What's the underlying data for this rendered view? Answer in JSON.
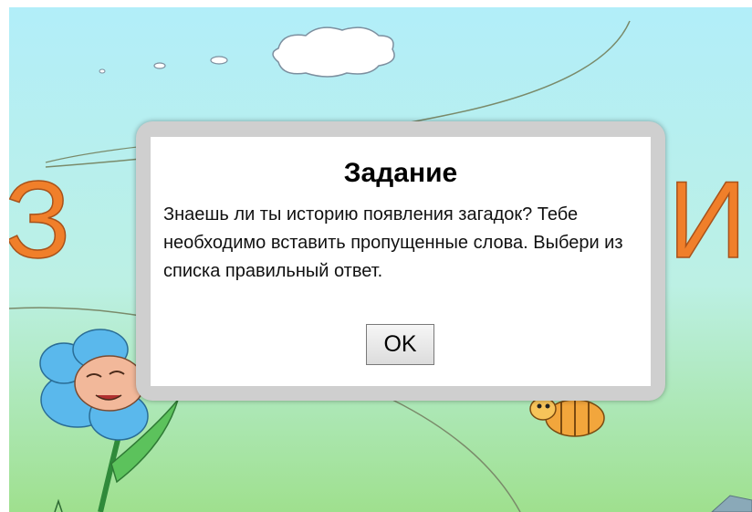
{
  "dialog": {
    "title": "Задание",
    "message": "Знаешь ли ты историю появления загадок? Тебе необходимо вставить пропущенные слова. Выбери из списка правильный ответ.",
    "ok_label": "OK"
  },
  "background": {
    "left_letter": "З",
    "right_letter": "И"
  },
  "colors": {
    "sky": "#b4f0f8",
    "grass": "#a6e09a",
    "letters": "#f07f2a",
    "flower": "#56b9ef",
    "bee": "#f2a63c"
  },
  "icons": [
    "cloud-icon",
    "flower-icon",
    "bee-icon"
  ]
}
